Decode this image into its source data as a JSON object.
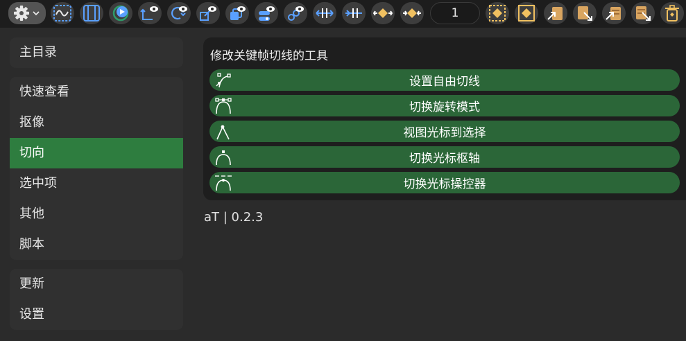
{
  "toolbar": {
    "settings_icon": "gear-icon",
    "frame_value": "1",
    "accent": "#5aa0ff",
    "key_color": "#f0c060"
  },
  "sidebar": {
    "groups": [
      {
        "items": [
          {
            "label": "主目录"
          }
        ]
      },
      {
        "items": [
          {
            "label": "快速查看"
          },
          {
            "label": "抠像"
          },
          {
            "label": "切向"
          },
          {
            "label": "选中项"
          },
          {
            "label": "其他"
          },
          {
            "label": "脚本"
          }
        ]
      },
      {
        "items": [
          {
            "label": "更新"
          },
          {
            "label": "设置"
          }
        ]
      }
    ],
    "active_label": "切向",
    "active_color": "#2e7d3f"
  },
  "panel": {
    "title": "修改关键帧切线的工具",
    "buttons": [
      {
        "label": "设置自由切线",
        "icon": "free-tangent-icon"
      },
      {
        "label": "切换旋转模式",
        "icon": "rotation-mode-icon"
      },
      {
        "label": "视图光标到选择",
        "icon": "cursor-to-selection-icon"
      },
      {
        "label": "切换光标枢轴",
        "icon": "cursor-pivot-icon"
      },
      {
        "label": "切换光标操控器",
        "icon": "cursor-gizmo-icon"
      }
    ],
    "button_color": "#2b6638"
  },
  "footer": {
    "version": "aT | 0.2.3"
  }
}
